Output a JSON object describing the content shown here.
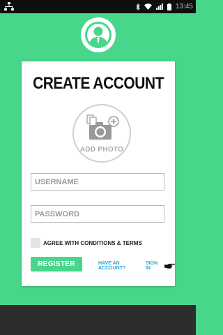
{
  "status_bar": {
    "time": "13:45",
    "icons": [
      "network-icon",
      "bluetooth-icon",
      "wifi-icon",
      "signal-icon",
      "battery-icon"
    ]
  },
  "logo": {
    "icon": "user-avatar-icon"
  },
  "form": {
    "title": "CREATE ACCOUNT",
    "add_photo_label": "ADD PHOTO",
    "username_placeholder": "USERNAME",
    "password_placeholder": "PASSWORD",
    "agree_label": "AGREE WITH CONDITIONS & TERMS",
    "register_label": "REGISTER",
    "have_account_text": "HAVE AN ACCOUNT?",
    "signin_label": "SIGN IN"
  },
  "colors": {
    "background": "#47d68a",
    "accent": "#47d68a",
    "link": "#2aa7d6",
    "status_bar": "#0f0f0f",
    "bottom_bar": "#2d2d2d"
  }
}
